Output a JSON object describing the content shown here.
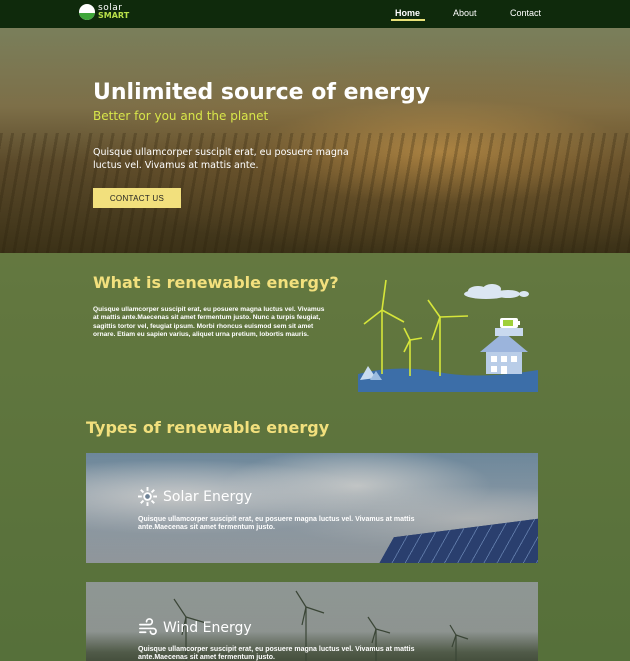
{
  "brand": {
    "line1": "solar",
    "line2": "SMART"
  },
  "nav": {
    "home": "Home",
    "about": "About",
    "contact": "Contact",
    "active": "Home"
  },
  "hero": {
    "title": "Unlimited source of energy",
    "subtitle": "Better for you and the planet",
    "text": "Quisque ullamcorper suscipit erat, eu posuere magna luctus vel. Vivamus at mattis ante.",
    "button": "CONTACT US"
  },
  "what": {
    "title": "What is renewable energy?",
    "text": "Quisque ullamcorper suscipit erat, eu posuere magna luctus vel. Vivamus at mattis ante.Maecenas sit amet fermentum justo. Nunc a turpis feugiat, sagittis tortor vel, feugiat ipsum. Morbi rhoncus euismod sem sit amet ornare. Etiam eu sapien varius, aliquet urna pretium, lobortis mauris."
  },
  "types": {
    "title": "Types of renewable energy",
    "cards": [
      {
        "title": "Solar Energy",
        "text": "Quisque ullamcorper suscipit erat, eu posuere magna luctus vel. Vivamus at mattis ante.Maecenas sit amet fermentum justo.",
        "icon": "sun-icon"
      },
      {
        "title": "Wind Energy",
        "text": "Quisque ullamcorper suscipit erat, eu posuere magna luctus vel. Vivamus at mattis ante.Maecenas sit amet fermentum justo.",
        "icon": "wind-icon"
      }
    ]
  },
  "colors": {
    "nav_bg": "#0f2a0c",
    "accent_yellow": "#f2e07d",
    "subtitle_green": "#d8e64a",
    "page_bg": "#62773f"
  }
}
